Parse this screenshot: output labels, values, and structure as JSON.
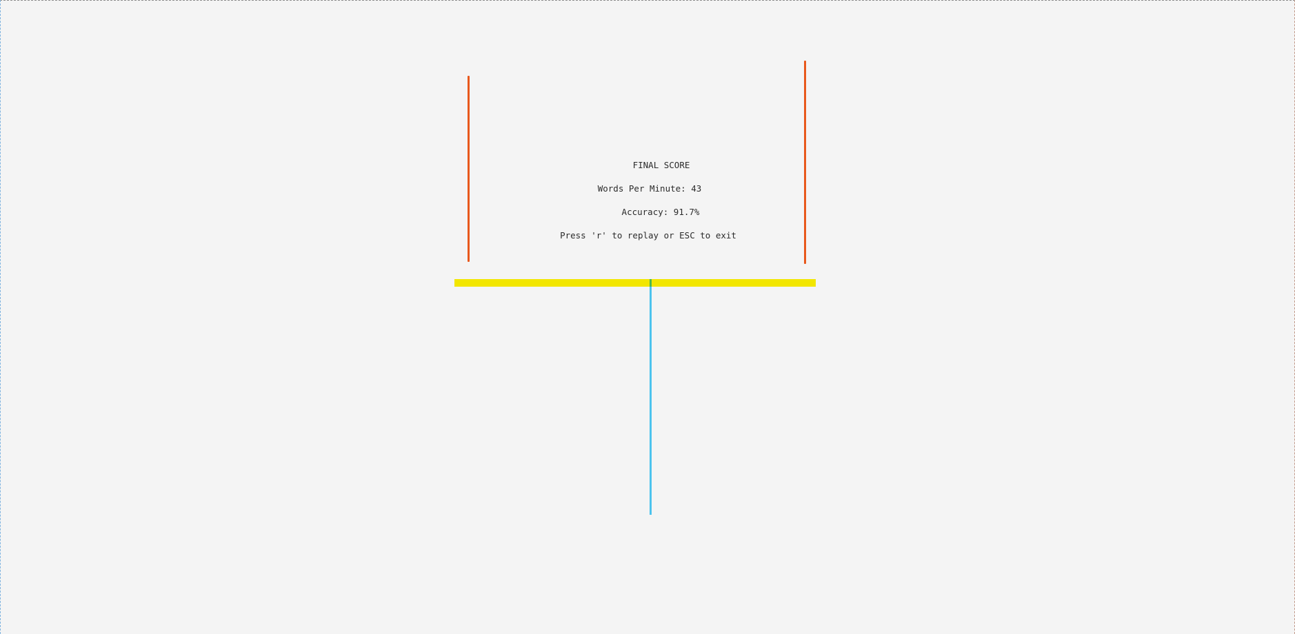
{
  "final_score": {
    "title": "FINAL SCORE",
    "wpm_label": "Words Per Minute: 43",
    "accuracy_label": "Accuracy: 91.7%",
    "hint": "Press 'r' to replay or ESC to exit"
  },
  "colors": {
    "background": "#f4f4f4",
    "goalposts": "#e8581c",
    "crossbar": "#f2e600",
    "crossbar_center": "#4cb84c",
    "stem": "#4cc3ee",
    "text": "#2b2b2b"
  }
}
